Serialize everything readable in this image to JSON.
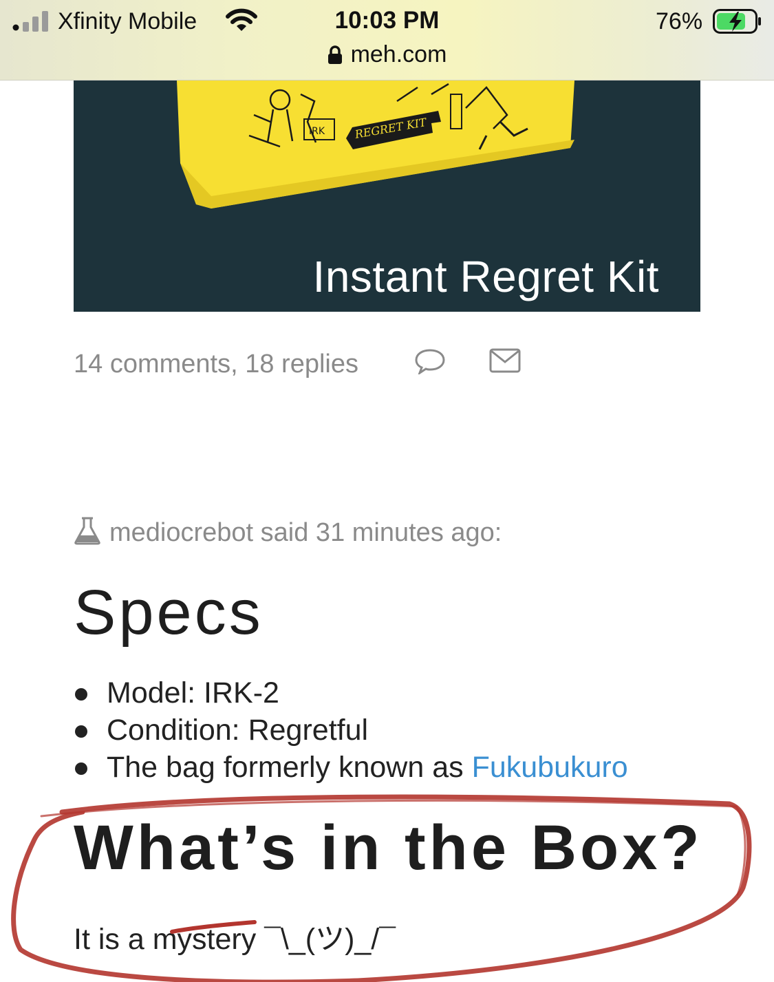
{
  "status_bar": {
    "carrier": "Xfinity Mobile",
    "time": "10:03 PM",
    "url": "meh.com",
    "battery_percent": "76%",
    "signal_bars_active": 1,
    "signal_bars_total": 4,
    "battery_fill_fraction": 0.76,
    "battery_charging": true
  },
  "hero": {
    "title": "Instant Regret Kit",
    "background_color": "#1d333b",
    "bag_color": "#f7df32",
    "bag_print_text": "INSTANT REGRET KIT"
  },
  "comments": {
    "count_text": "14 comments, 18 replies"
  },
  "post": {
    "author_line": "mediocrebot said 31 minutes ago:",
    "specs_heading": "Specs",
    "specs": [
      {
        "text": "Model: IRK-2"
      },
      {
        "text": "Condition: Regretful"
      },
      {
        "text": "The bag formerly known as ",
        "link": "Fukubukuro"
      }
    ],
    "box_heading": "What’s in the Box?",
    "box_text": "It is a mystery ¯\\_(ツ)_/¯"
  },
  "colors": {
    "link": "#3a8fd2",
    "muted_text": "#8a8a8a",
    "annotation_red": "#b3352e"
  },
  "annotation": {
    "type": "hand-drawn red ellipse around box heading and text"
  }
}
